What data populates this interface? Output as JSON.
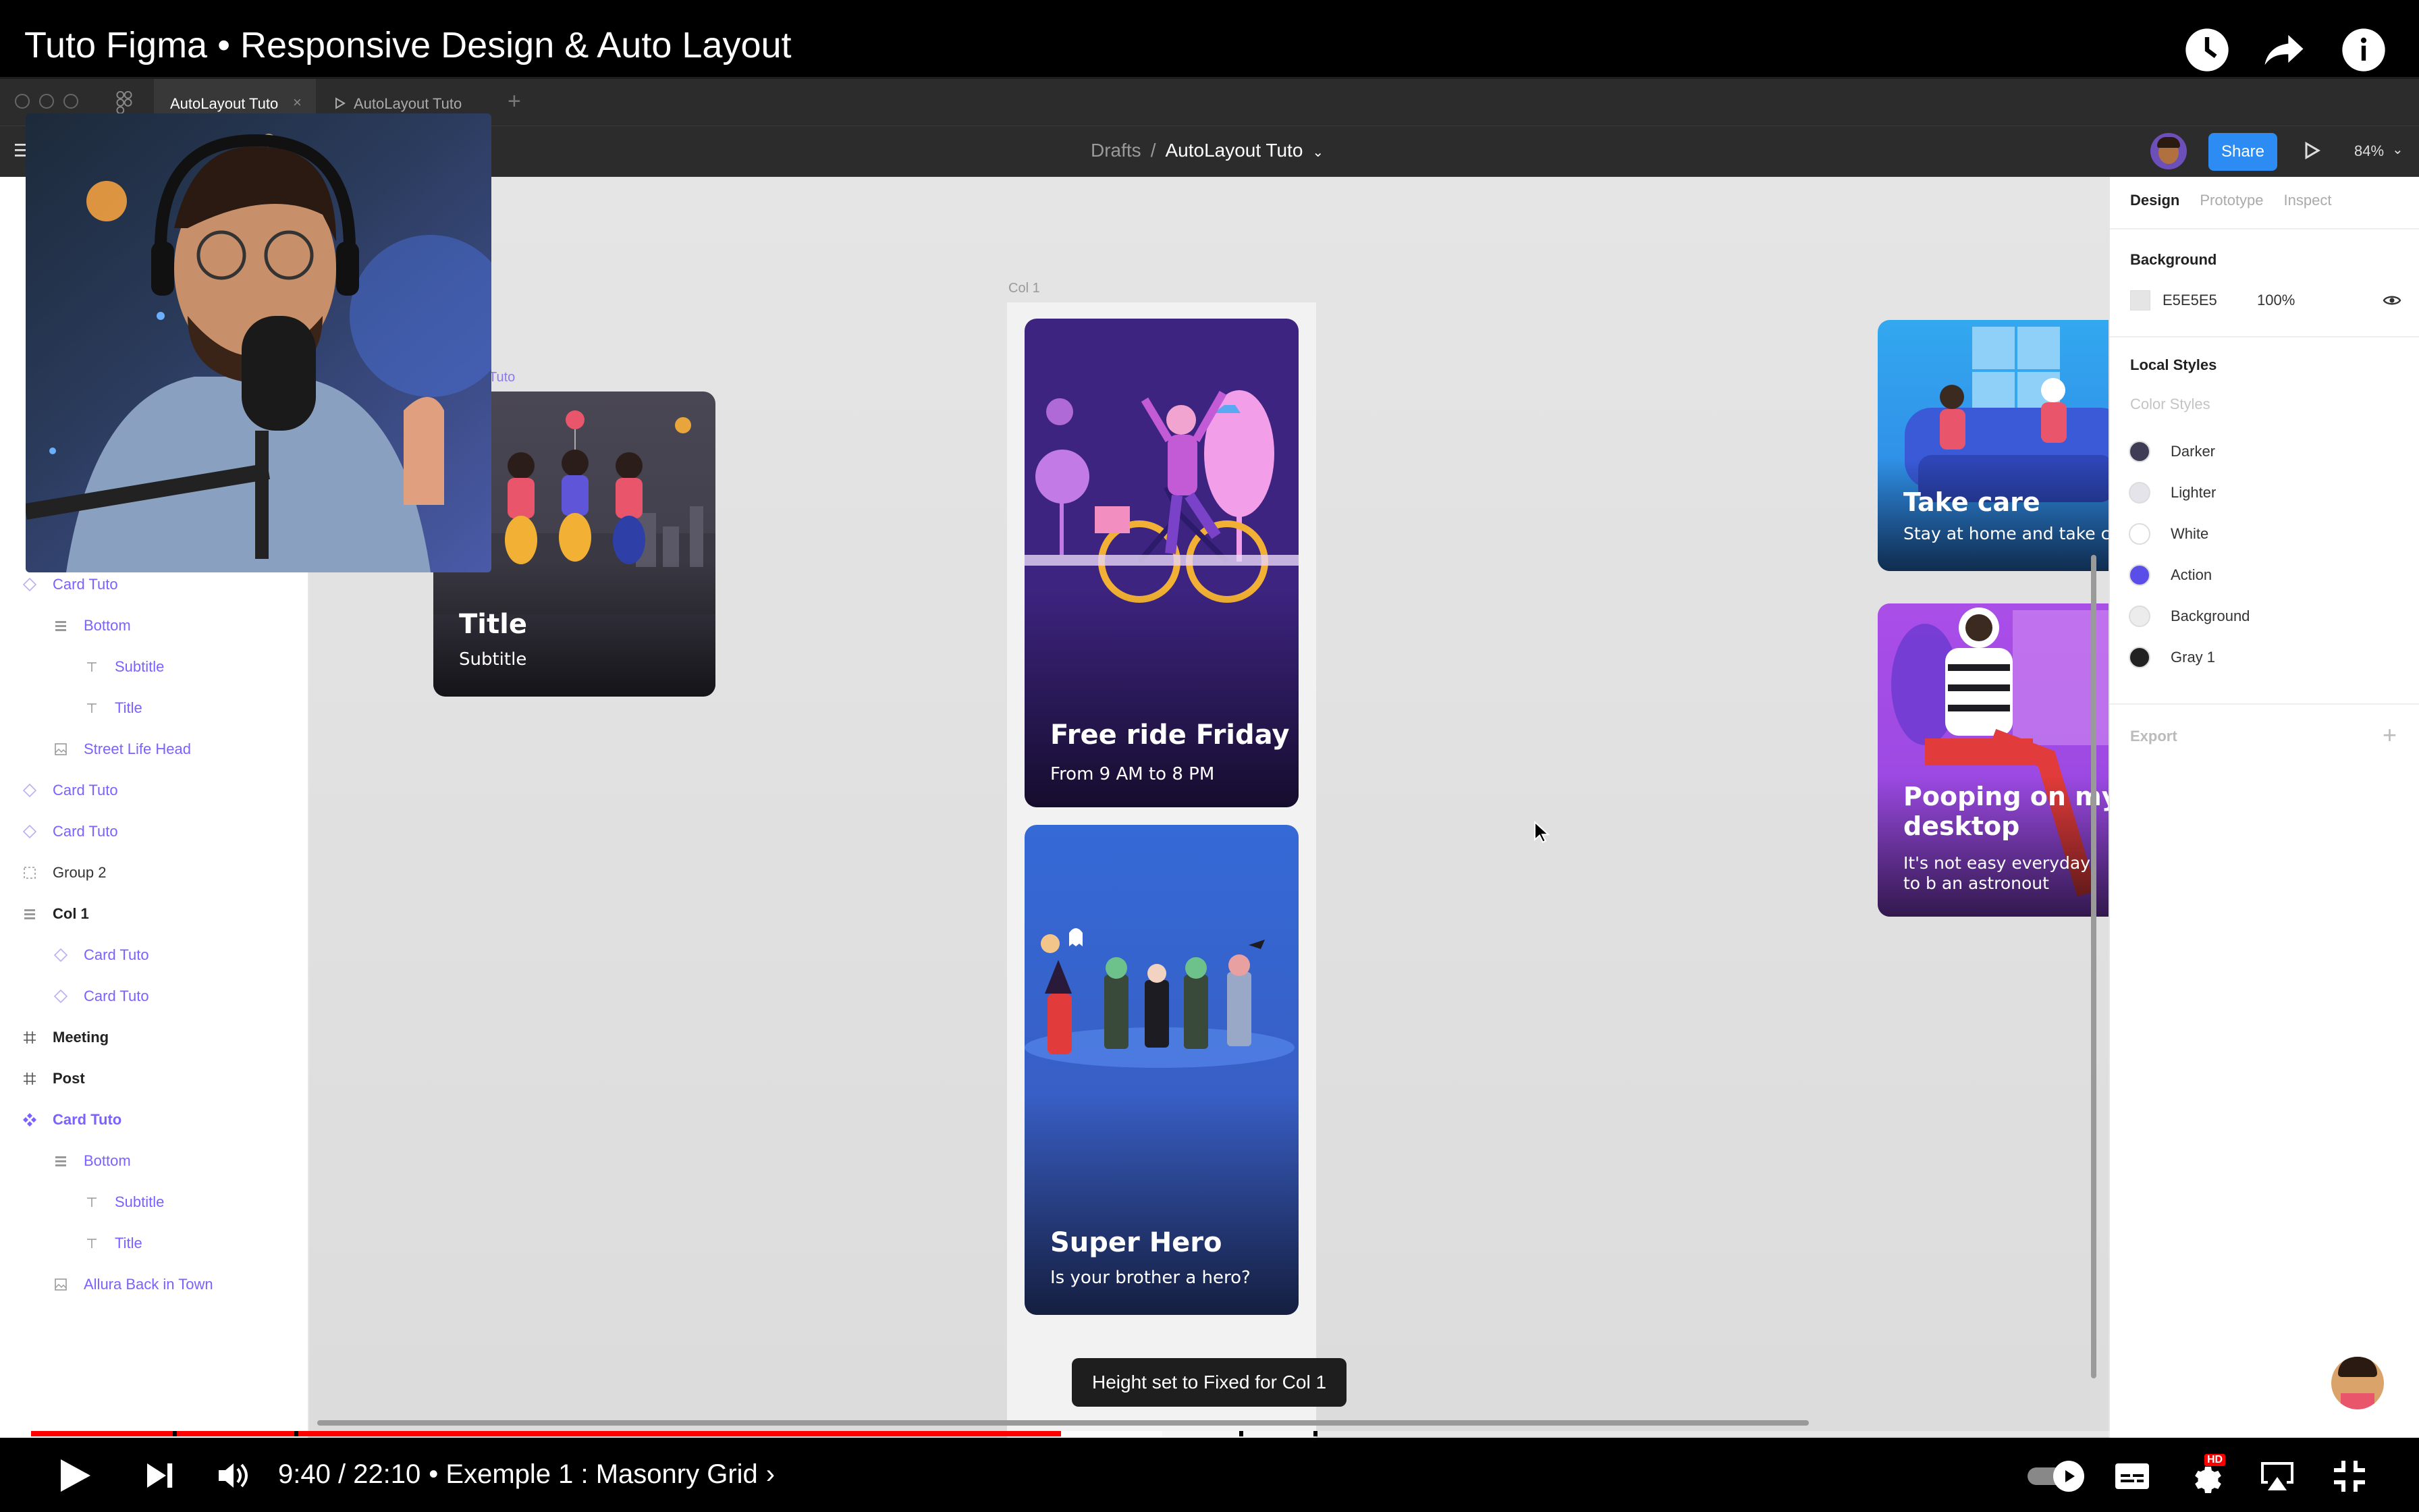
{
  "video": {
    "title": "Tuto Figma • Responsive Design & Auto Layout",
    "time": "9:40 / 22:10",
    "chapter": "• Exemple 1 : Masonry Grid",
    "progress_played": 0.437,
    "progress_buffered": 0.48
  },
  "figma": {
    "tabs": [
      "AutoLayout Tuto",
      "AutoLayout Tuto"
    ],
    "breadcrumb": {
      "root": "Drafts",
      "separator": "/",
      "file": "AutoLayout Tuto"
    },
    "share_label": "Share",
    "zoom": "84%"
  },
  "layers": [
    {
      "label": "Card Tuto",
      "icon": "component-instance-icon",
      "level": 0,
      "style": "purple"
    },
    {
      "label": "Bottom",
      "icon": "autolayout-icon",
      "level": 1,
      "style": "purple"
    },
    {
      "label": "Subtitle",
      "icon": "text-icon",
      "level": 2,
      "style": "purple"
    },
    {
      "label": "Title",
      "icon": "text-icon",
      "level": 2,
      "style": "purple"
    },
    {
      "label": "Street Life Head",
      "icon": "image-icon",
      "level": 1,
      "style": "purple"
    },
    {
      "label": "Card Tuto",
      "icon": "component-instance-icon",
      "level": 0,
      "style": "purple"
    },
    {
      "label": "Card Tuto",
      "icon": "component-instance-icon",
      "level": 0,
      "style": "purple"
    },
    {
      "label": "Group 2",
      "icon": "group-icon",
      "level": 0,
      "style": "normal"
    },
    {
      "label": "Col 1",
      "icon": "autolayout-icon",
      "level": 0,
      "style": "bold"
    },
    {
      "label": "Card Tuto",
      "icon": "component-instance-icon",
      "level": 1,
      "style": "purple"
    },
    {
      "label": "Card Tuto",
      "icon": "component-instance-icon",
      "level": 1,
      "style": "purple"
    },
    {
      "label": "Meeting",
      "icon": "frame-icon",
      "level": 0,
      "style": "bold"
    },
    {
      "label": "Post",
      "icon": "frame-icon",
      "level": 0,
      "style": "bold"
    },
    {
      "label": "Card Tuto",
      "icon": "component-icon",
      "level": 0,
      "style": "purplebold"
    },
    {
      "label": "Bottom",
      "icon": "autolayout-icon",
      "level": 1,
      "style": "purple"
    },
    {
      "label": "Subtitle",
      "icon": "text-icon",
      "level": 2,
      "style": "purple"
    },
    {
      "label": "Title",
      "icon": "text-icon",
      "level": 2,
      "style": "purple"
    },
    {
      "label": "Allura Back in Town",
      "icon": "image-icon",
      "level": 1,
      "style": "purple"
    }
  ],
  "canvas": {
    "col1_label": "Col 1",
    "frame_label_partial": "Tuto",
    "cards": {
      "title_card": {
        "title": "Title",
        "subtitle": "Subtitle"
      },
      "free_ride": {
        "title": "Free ride Friday",
        "subtitle": "From 9 AM to 8 PM"
      },
      "super_hero": {
        "title": "Super Hero",
        "subtitle": "Is your brother a hero?"
      },
      "take_care": {
        "title": "Take care",
        "subtitle": "Stay at home and take ca"
      },
      "pooping": {
        "title": "Pooping on my desktop",
        "subtitle": "It's not easy everyday to b an astronout"
      }
    },
    "toast": "Height set to Fixed for Col 1"
  },
  "design_panel": {
    "tabs": [
      "Design",
      "Prototype",
      "Inspect"
    ],
    "background_heading": "Background",
    "bg_hex": "E5E5E5",
    "bg_opacity": "100%",
    "local_styles_heading": "Local Styles",
    "color_styles_heading": "Color Styles",
    "styles": [
      {
        "name": "Darker",
        "color": "#3f3d56"
      },
      {
        "name": "Lighter",
        "color": "#e4e4ea"
      },
      {
        "name": "White",
        "color": "#ffffff"
      },
      {
        "name": "Action",
        "color": "#5b4ee8"
      },
      {
        "name": "Background",
        "color": "#ececec"
      },
      {
        "name": "Gray 1",
        "color": "#222222"
      }
    ],
    "export_heading": "Export"
  },
  "colors": {
    "accent_blue": "#2c8cf4",
    "purple_layer": "#7b61ff",
    "progress_red": "#ff0000"
  }
}
